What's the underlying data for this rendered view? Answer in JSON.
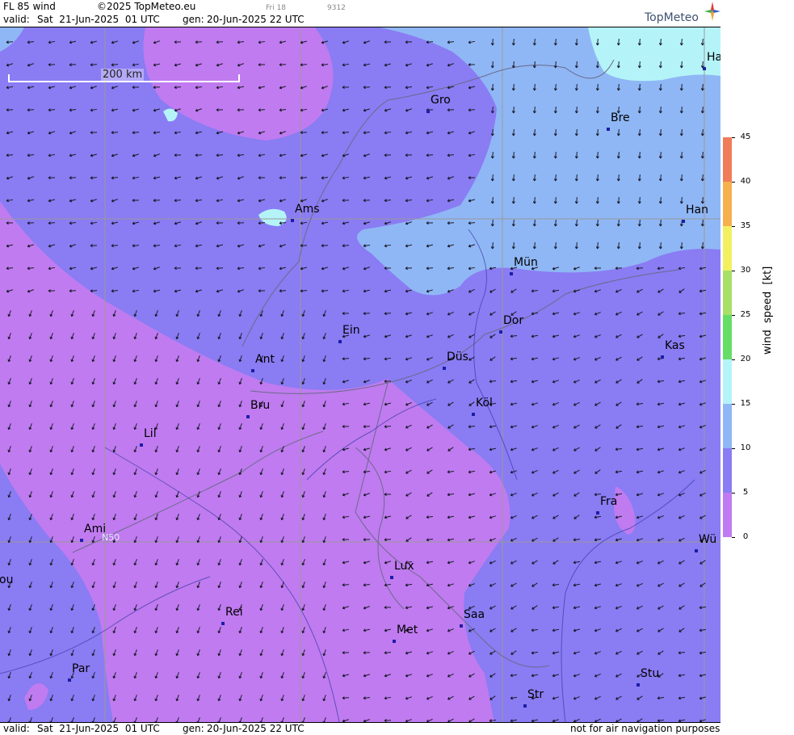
{
  "header": {
    "product": "FL 85 wind",
    "copyright": "©2025 TopMeteo.eu",
    "valid_label": "valid:",
    "valid_value": "Sat  21-Jun-2025  01 UTC",
    "gen_label": "gen:",
    "gen_value": "20-Jun-2025 22 UTC",
    "faint_day": "Fri 18",
    "faint_code": "9312",
    "brand": "TopMeteo"
  },
  "footer": {
    "valid_label": "valid:",
    "valid_value": "Sat  21-Jun-2025  01 UTC",
    "gen_label": "gen:",
    "gen_value": "20-Jun-2025 22 UTC",
    "disclaimer": "not for air navigation purposes"
  },
  "map": {
    "scale_label": "200 km",
    "lat_label": "N50",
    "cities": [
      {
        "name": "Ha"
      },
      {
        "name": "Gro"
      },
      {
        "name": "Bre"
      },
      {
        "name": "Ams"
      },
      {
        "name": "Han"
      },
      {
        "name": "Mün"
      },
      {
        "name": "Dor"
      },
      {
        "name": "Ein"
      },
      {
        "name": "Kas"
      },
      {
        "name": "Ant"
      },
      {
        "name": "Düs"
      },
      {
        "name": "Bru"
      },
      {
        "name": "Köl"
      },
      {
        "name": "Lil"
      },
      {
        "name": "Fra"
      },
      {
        "name": "Ami"
      },
      {
        "name": "Wü"
      },
      {
        "name": "ou"
      },
      {
        "name": "Lux"
      },
      {
        "name": "Rei"
      },
      {
        "name": "Saa"
      },
      {
        "name": "Met"
      },
      {
        "name": "Par"
      },
      {
        "name": "Stu"
      },
      {
        "name": "Str"
      }
    ]
  },
  "legend": {
    "unit": "wind  speed  [kt]",
    "ticks": [
      "45",
      "40",
      "35",
      "30",
      "25",
      "20",
      "15",
      "10",
      "5",
      "0"
    ],
    "colors": {
      "0-5": "#c07bf0",
      "5-10": "#8a7cf3",
      "10-15": "#8fb7f5",
      "15-20": "#b4f4f8",
      "20-25": "#66dd66",
      "25-30": "#a8e066",
      "30-35": "#f2f060",
      "35-40": "#f6b04e",
      "40-45": "#f07c5a"
    }
  },
  "colors": {
    "purple_low": "#c07bf0",
    "violet": "#8a7cf3",
    "light_blue": "#8fb7f5",
    "cyan": "#b4f4f8",
    "city_dot": "#1d1da8",
    "brand": "#3f5170"
  }
}
